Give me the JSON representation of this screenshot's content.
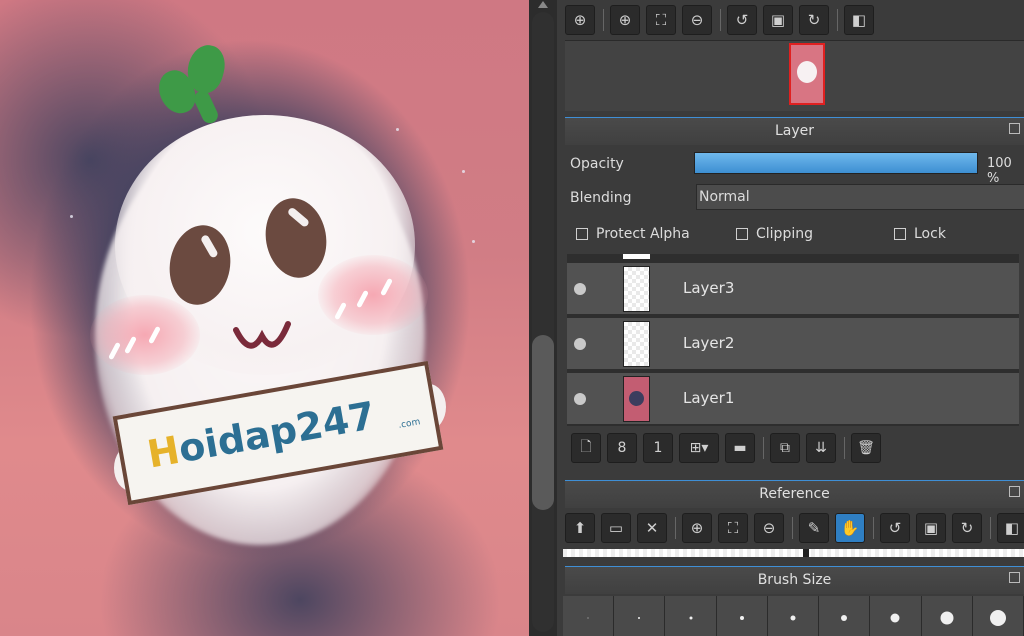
{
  "canvas": {
    "sign_text_prefix": "H",
    "sign_text": "oidap247",
    "sign_sub": ".com"
  },
  "navigator_toolbar": {
    "buttons": [
      "zoom-fit-icon",
      "zoom-in-icon",
      "fit-screen-icon",
      "zoom-out-icon",
      "rotate-left-icon",
      "actual-size-icon",
      "rotate-right-icon",
      "flip-icon"
    ]
  },
  "layer_panel": {
    "title": "Layer",
    "opacity_label": "Opacity",
    "opacity_value": "100 %",
    "opacity_fraction": 1.0,
    "blending_label": "Blending",
    "blending_value": "Normal",
    "protect_alpha": "Protect Alpha",
    "clipping": "Clipping",
    "lock": "Lock",
    "layers": [
      {
        "name": "Layer3"
      },
      {
        "name": "Layer2"
      },
      {
        "name": "Layer1"
      }
    ]
  },
  "reference_panel": {
    "title": "Reference"
  },
  "brush_size_panel": {
    "title": "Brush Size"
  },
  "colors": {
    "accent": "#3f8fd6",
    "active_tool": "#2f7fc3"
  }
}
